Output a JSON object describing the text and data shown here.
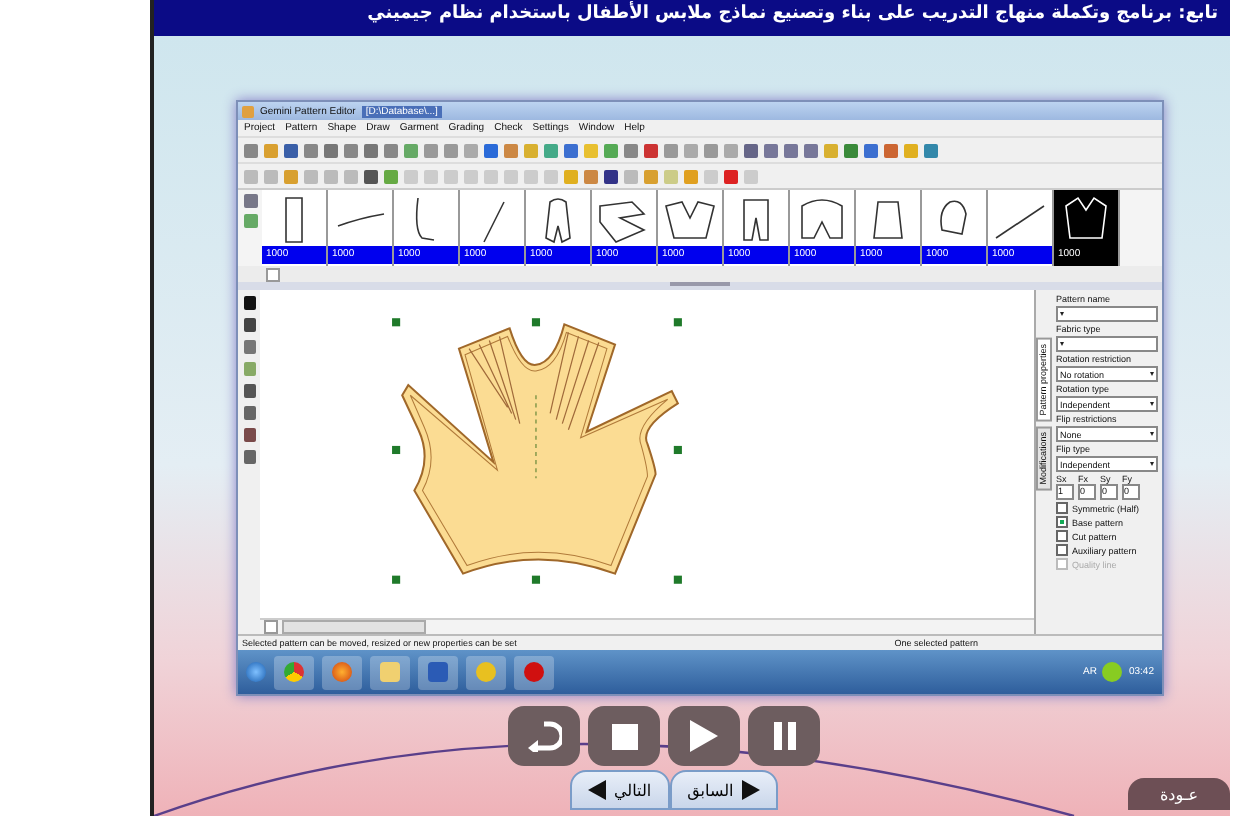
{
  "header": {
    "title": "تابع: برنامج وتكملة منهاج التدريب على بناء وتصنيع نماذج ملابس الأطفال باستخدام نظام جيميني"
  },
  "app_window": {
    "title": "Gemini Pattern Editor",
    "file_path": "[D:\\Database\\...]",
    "menu": [
      "Project",
      "Pattern",
      "Shape",
      "Draw",
      "Garment",
      "Grading",
      "Check",
      "Settings",
      "Window",
      "Help"
    ],
    "thumbnails": [
      {
        "label": "1000",
        "selected": false
      },
      {
        "label": "1000",
        "selected": false
      },
      {
        "label": "1000",
        "selected": false
      },
      {
        "label": "1000",
        "selected": false
      },
      {
        "label": "1000",
        "selected": false
      },
      {
        "label": "1000",
        "selected": false
      },
      {
        "label": "1000",
        "selected": false
      },
      {
        "label": "1000",
        "selected": false
      },
      {
        "label": "1000",
        "selected": false
      },
      {
        "label": "1000",
        "selected": false
      },
      {
        "label": "1000",
        "selected": false
      },
      {
        "label": "1000",
        "selected": false
      },
      {
        "label": "1000",
        "selected": true
      }
    ],
    "side_panel": {
      "tabs": [
        {
          "label": "Pattern properties",
          "selected": true
        },
        {
          "label": "Modifications",
          "selected": false
        }
      ],
      "fields": [
        {
          "label": "Pattern name"
        },
        {
          "label": "Fabric type"
        },
        {
          "label": "Rotation restriction",
          "value": "No rotation"
        },
        {
          "label": "Rotation type",
          "value": "Independent"
        },
        {
          "label": "Flip restrictions",
          "value": "None"
        },
        {
          "label": "Flip type",
          "value": "Independent"
        }
      ],
      "factors": [
        {
          "label": "Sx",
          "value": "1"
        },
        {
          "label": "Fx",
          "value": "0"
        },
        {
          "label": "Sy",
          "value": "0"
        },
        {
          "label": "Fy",
          "value": "0"
        }
      ],
      "options": [
        {
          "label": "Symmetric (Half)",
          "checked": false,
          "disabled": false
        },
        {
          "label": "Base pattern",
          "checked": true,
          "disabled": false
        },
        {
          "label": "Cut pattern",
          "checked": false,
          "disabled": false
        },
        {
          "label": "Auxiliary pattern",
          "checked": false,
          "disabled": false
        },
        {
          "label": "Quality line",
          "checked": false,
          "disabled": true
        }
      ]
    },
    "status_bar": {
      "left": "Selected pattern can be moved, resized or new properties can be set",
      "right": "One selected pattern"
    },
    "taskbar": {
      "language": "AR",
      "clock": "03:42"
    }
  },
  "player": {
    "controls": [
      {
        "kind": "replay"
      },
      {
        "kind": "stop"
      },
      {
        "kind": "play"
      },
      {
        "kind": "pause"
      }
    ],
    "nav": [
      {
        "label": "السابق",
        "kind": "previous"
      },
      {
        "label": "التالي",
        "kind": "next"
      }
    ],
    "back_button": "عـودة"
  }
}
